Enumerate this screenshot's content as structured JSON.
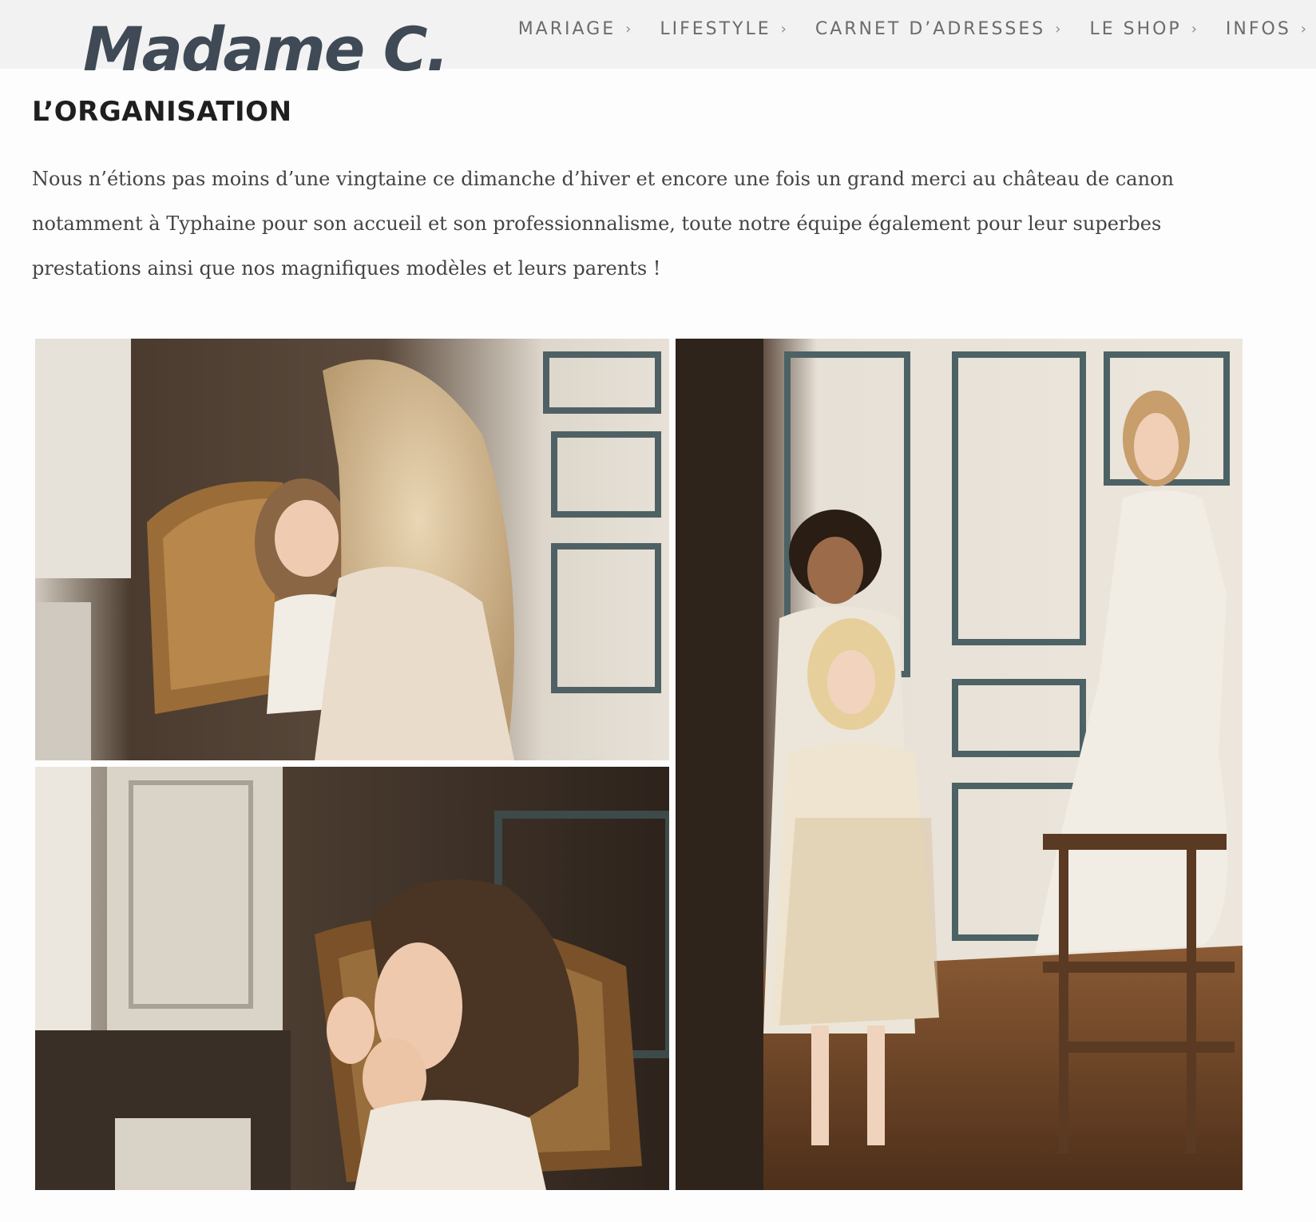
{
  "site": {
    "logo_text": "Madame C."
  },
  "nav": {
    "items": [
      {
        "label": "MARIAGE",
        "chevron": "›"
      },
      {
        "label": "LIFESTYLE",
        "chevron": "›"
      },
      {
        "label": "CARNET D’ADRESSES",
        "chevron": "›"
      },
      {
        "label": "LE SHOP",
        "chevron": "›"
      },
      {
        "label": "INFOS",
        "chevron": "›"
      }
    ]
  },
  "article": {
    "section_title": "L’ORGANISATION",
    "intro_text": "Nous n’étions pas moins d’une vingtaine ce dimanche d’hiver et encore une fois un grand merci au château de canon notamment à Typhaine pour son accueil et son professionnalisme, toute notre équipe également pour leur superbes prestations ainsi que nos magnifiques modèles et leurs parents !"
  },
  "gallery": {
    "photos": [
      {
        "subject": "smiling toddler in lace dress beside cane chair with blonde girl in foreground"
      },
      {
        "subject": "boy in white suit, blonde girl in floral dress and woman in white gown in paneled room"
      },
      {
        "subject": "toddler rubbing eye near window and cane chair"
      }
    ]
  }
}
